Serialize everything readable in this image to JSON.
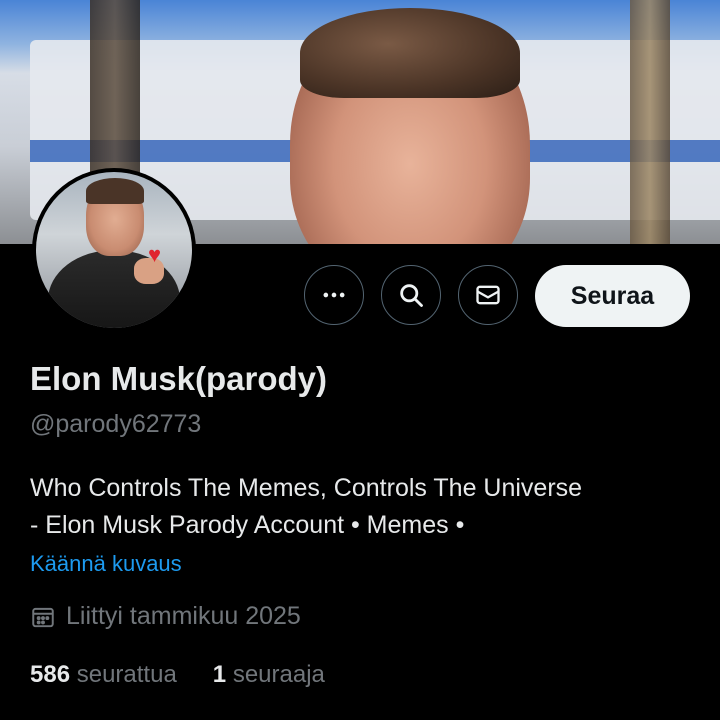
{
  "banner": {
    "icon": "banner-photo"
  },
  "avatar": {
    "icon": "avatar-photo"
  },
  "actions": {
    "more_icon": "more-icon",
    "search_icon": "search-icon",
    "message_icon": "envelope-icon",
    "follow_label": "Seuraa"
  },
  "profile": {
    "name": "Elon Musk(parody)",
    "handle": "@parody62773",
    "bio_line1": "Who Controls The Memes, Controls The Universe",
    "bio_line2": "- Elon Musk Parody Account • Memes •",
    "translate_label": "Käännä kuvaus",
    "joined": "Liittyi tammikuu 2025",
    "following_count": "586",
    "following_label": "seurattua",
    "followers_count": "1",
    "followers_label": "seuraaja"
  },
  "colors": {
    "background": "#000000",
    "text_primary": "#e7e9ea",
    "text_secondary": "#71767b",
    "link": "#1d9bf0",
    "follow_button_bg": "#eff3f4"
  }
}
